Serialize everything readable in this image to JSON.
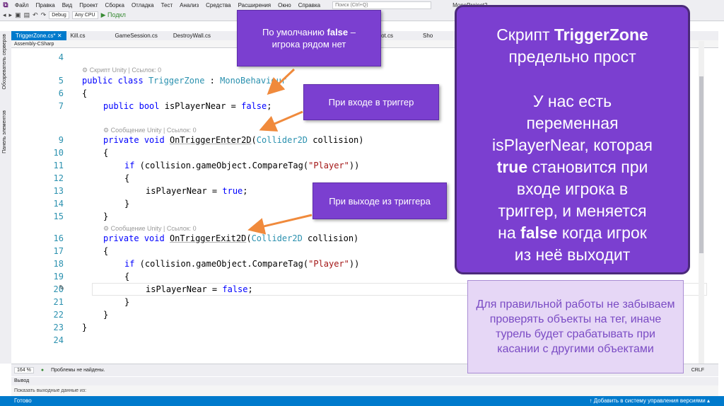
{
  "menubar": {
    "logo": "⧉",
    "items": [
      "Файл",
      "Правка",
      "Вид",
      "Проект",
      "Сборка",
      "Отладка",
      "Тест",
      "Анализ",
      "Средства",
      "Расширения",
      "Окно",
      "Справка"
    ],
    "search_placeholder": "Поиск (Ctrl+Q)",
    "project_title": "MonoProject2"
  },
  "toolbar": {
    "config": "Debug",
    "platform": "Any CPU",
    "run_label": "▶ Подкл"
  },
  "tabs": [
    {
      "label": "TriggerZone.cs*  ✕",
      "active": true
    },
    {
      "label": "Kill.cs"
    },
    {
      "label": "GameSession.cs"
    },
    {
      "label": "DestroyWall.cs"
    },
    {
      "label": "EnemyShoot.cs"
    },
    {
      "label": "Sho"
    }
  ],
  "navbar": {
    "project": "Assembly-CSharp"
  },
  "side_panel": {
    "server_explorer": "Обозреватель серверов",
    "toolbox": "Панель элементов"
  },
  "code": {
    "lens_script": "⚙ Скрипт Unity | Ссылок: 0",
    "lens_msg1": "⚙ Сообщение Unity | Ссылок: 0",
    "lens_msg2": "⚙ Сообщение Unity | Ссылок: 0",
    "lines": {
      "n4": "4",
      "n5": "5",
      "n6": "6",
      "n7": "7",
      "n9": "9",
      "n10": "10",
      "n11": "11",
      "n12": "12",
      "n13": "13",
      "n14": "14",
      "n15": "15",
      "n16": "16",
      "n17": "17",
      "n18": "18",
      "n19": "19",
      "n20": "20",
      "n21": "21",
      "n22": "22",
      "n23": "23",
      "n24": "24"
    },
    "tokens": {
      "public": "public",
      "class": "class",
      "classname": "TriggerZone",
      "colon": " : ",
      "base": "MonoBehaviour",
      "open": "{",
      "close": "}",
      "bool": "bool",
      "field": " isPlayerNear = ",
      "false": "false",
      "true": "true",
      "semi": ";",
      "private": "private",
      "void": "void",
      "enter": "OnTriggerEnter2D",
      "exit": "OnTriggerExit2D",
      "collider": "Collider2D",
      "param": " collision)",
      "if": "if",
      "cond": " (collision.gameObject.CompareTag(",
      "player": "\"Player\"",
      "cond_end": "))",
      "assign": "isPlayerNear = ",
      "paren": "("
    }
  },
  "status": {
    "zoom": "164 %",
    "problems": "Проблемы не найдены.",
    "crlf": "CRLF"
  },
  "output": {
    "title": "Вывод",
    "body": "Показать выходные данные из:"
  },
  "bottom_status": {
    "left": "Готово",
    "right": "↑ Добавить в систему управления версиями ▴"
  },
  "callouts": {
    "c1_pre": "По умолчанию ",
    "c1_bold": "false",
    "c1_post": " –",
    "c1_line2": "игрока рядом нет",
    "c2": "При входе в триггер",
    "c3": "При выходе из триггера"
  },
  "panel": {
    "l1_pre": "Скрипт ",
    "l1_bold": "TriggerZone",
    "l2": "предельно прост",
    "l3": "У нас есть",
    "l4": "переменная",
    "l5": "isPlayerNear, которая",
    "l6_bold": "true",
    "l6_post": " становится при",
    "l7": "входе игрока в",
    "l8": "триггер, и меняется",
    "l9_pre": "на ",
    "l9_bold": "false",
    "l9_post": " когда игрок",
    "l10": "из неё выходит"
  },
  "note": "Для правильной работы не забываем проверять объекты на тег, иначе турель будет срабатывать при касании с другими объектами",
  "colors": {
    "accent": "#7b3fd0",
    "arrow": "#f08a3c",
    "vs_blue": "#007acc"
  }
}
